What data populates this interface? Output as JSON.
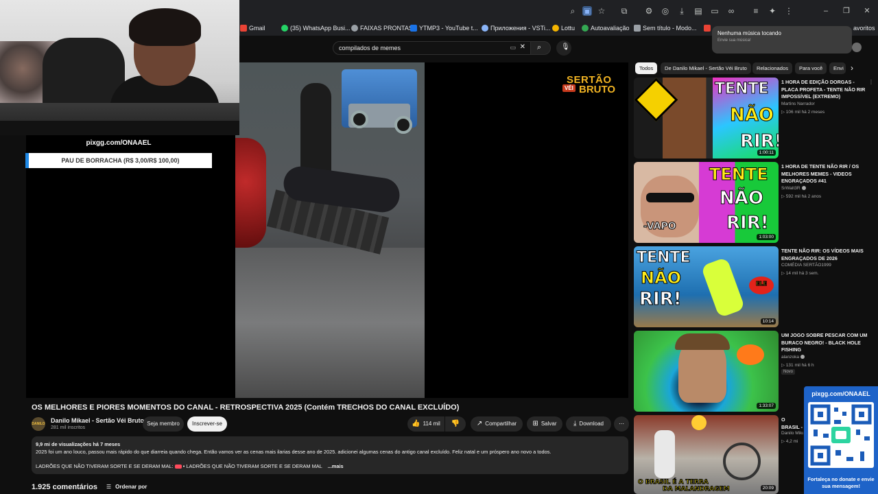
{
  "browser": {
    "bookmarks": [
      {
        "label": "Gmail",
        "color": "#ea4335"
      },
      {
        "label": "(35) WhatsApp Busi...",
        "color": "#25d366"
      },
      {
        "label": "FAIXAS PRONTAS",
        "color": "#9aa0a6"
      },
      {
        "label": "YTMP3 - YouTube t...",
        "color": "#1a73e8"
      },
      {
        "label": "Приложения - VSTi...",
        "color": "#8ab4f8"
      },
      {
        "label": "Lottu",
        "color": "#f4b400"
      },
      {
        "label": "Autoavaliação",
        "color": "#34a853"
      },
      {
        "label": "Sem título - Modo...",
        "color": "#9aa0a6"
      },
      {
        "label": "avoritos",
        "color": "#202124"
      }
    ]
  },
  "notification": {
    "title": "Nenhuma música tocando",
    "subtitle": "Envie sua música!"
  },
  "search": {
    "query": "compilados de memes"
  },
  "overlay": {
    "donate_url": "pixgg.com/ONAAEL",
    "donate_item": "PAU DE BORRACHA (R$ 3,00/R$ 100,00)"
  },
  "watermark": {
    "line1": "SERTÃO",
    "badge": "VÉI",
    "line2": "BRUTO"
  },
  "video": {
    "title": "OS MELHORES E PIORES MOMENTOS DO CANAL - RETROSPECTIVA 2025 (Contém TRECHOS DO CANAL EXCLUÍDO)",
    "channel_avatar_text": "DANILO",
    "channel": "Danilo Mikael - Sertão Véi Bruto",
    "subscribers": "281 mil inscritos",
    "member_label": "Seja membro",
    "subscribe_label": "Inscrever-se",
    "likes": "114 mil",
    "share_label": "Compartilhar",
    "save_label": "Salvar",
    "download_label": "Download",
    "description": {
      "stats": "9,9 mi de visualizações  há 7 meses",
      "text": "2025 foi um ano louco, passou mais rápido do que diarreia quando chega. Então vamos ver as cenas mais ilarias desse ano de 2025. adicionei algumas cenas do antigo canal excluído. Feliz natal e um próspero ano novo a todos.",
      "line2_a": "LADRÕES QUE NÃO TIVERAM SORTE E SE DERAM MAL:",
      "line2_b": "• LADRÕES QUE NÃO TIVERAM SORTE E SE DERAM MAL",
      "more": "...mais"
    },
    "comments_count": "1.925 comentários",
    "sort_label": "Ordenar por"
  },
  "chips": [
    "Todos",
    "De Danilo Mikael - Sertão Véi Bruto",
    "Relacionados",
    "Para você",
    "Envi"
  ],
  "recommendations": [
    {
      "title": "1 HORA DE EDIÇÃO DORGAS - PLACA PROFETA - TENTE NÃO RIR IMPOSSÍVEL (EXTREMO)",
      "channel": "Martins Narrador",
      "meta": "▷ 106 mil  há 2 meses",
      "duration": "1:00:11",
      "thumb_text": [
        "TENTE",
        "NÃO",
        "RIR!"
      ]
    },
    {
      "title": "1 HORA DE TENTE NÃO RIR / OS MELHORES MEMES - VIDEOS ENGRAÇADOS #41",
      "channel": "SrWalt3R",
      "meta": "▷ 592 mil  há 2 anos",
      "duration": "1:03:00",
      "thumb_text": [
        "TENTE",
        "NÃO",
        "RIR!",
        "-VAPO"
      ]
    },
    {
      "title": "TENTE NÃO RIR: OS VÍDEOS MAIS ENGRAÇADOS DE 2026",
      "channel": "COMÉDIA SERTÃO1999",
      "meta": "▷ 14 mil  há 3 sem.",
      "duration": "10:14",
      "thumb_text": [
        "TENTE",
        "NÃO",
        "RIR!",
        "ELE"
      ]
    },
    {
      "title": "UM JOGO SOBRE PESCAR COM UM BURACO NEGRO! - BLACK HOLE FISHING",
      "channel": "alanzoka",
      "meta": "▷ 131 mil  há 6 h",
      "badge": "Novo",
      "duration": "1:33:07"
    },
    {
      "title": "O BRASIL - ESSE PA",
      "channel": "Danilo Miku",
      "meta": "▷ 4,2 mi",
      "duration": "20:09",
      "thumb_text": [
        "O BRASIL É A TERRA",
        "DA MALANDRAGEM"
      ]
    }
  ],
  "qr": {
    "url": "pixgg.com/ONAAEL",
    "cta": "Fortaleça no donate e envie sua mensagem!"
  }
}
